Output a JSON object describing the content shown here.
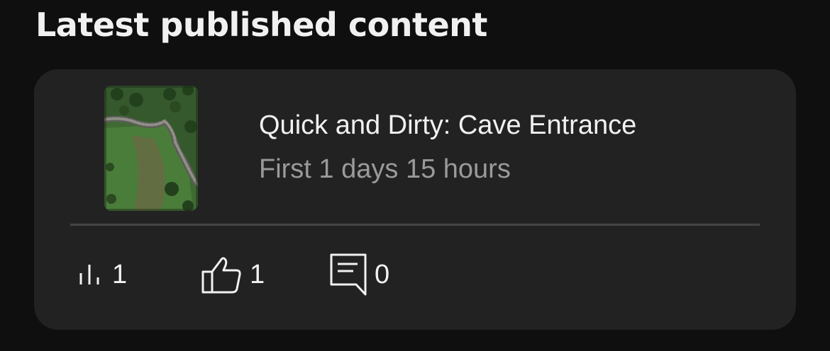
{
  "section": {
    "title": "Latest published content"
  },
  "video": {
    "title": "Quick and Dirty: Cave Entrance",
    "meta": "First 1 days 15 hours",
    "thumbnail_icon": "map-thumbnail"
  },
  "stats": {
    "views": "1",
    "likes": "1",
    "comments": "0"
  },
  "colors": {
    "background": "#0f0f0f",
    "card": "#222222",
    "text_primary": "#f1f1f1",
    "text_secondary": "#9a9a9a",
    "divider": "#444444"
  }
}
